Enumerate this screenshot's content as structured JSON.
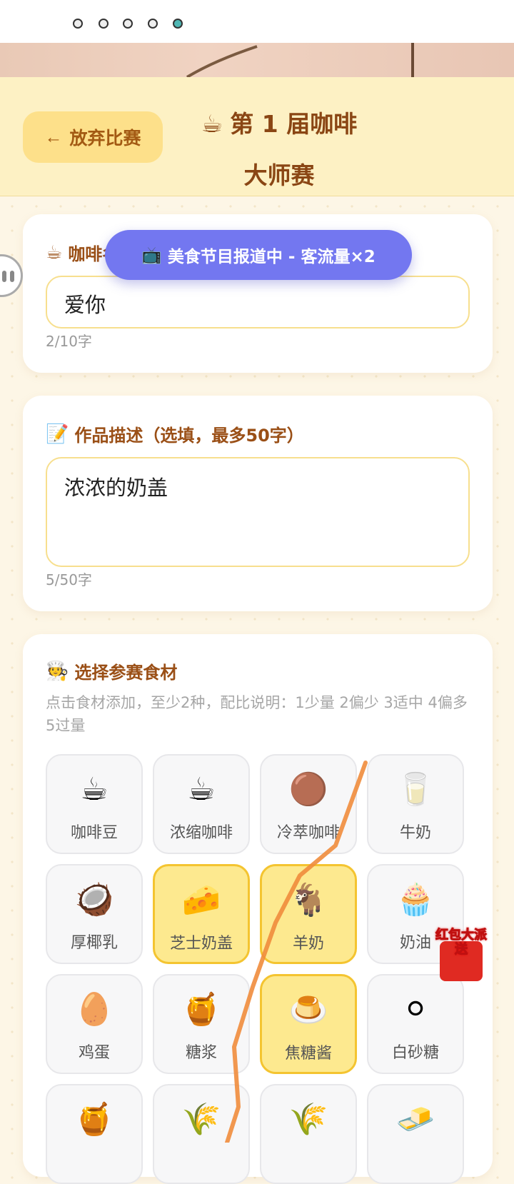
{
  "status_icons": [
    "notification-icon",
    "notification-icon",
    "notification-icon",
    "notification-icon",
    "notification-icon"
  ],
  "header": {
    "back_label": "放弃比赛",
    "title_emoji": "☕",
    "title_line1": "第 1 届咖啡",
    "title_line2": "大师赛"
  },
  "toast": {
    "icon": "📺",
    "text": "美食节目报道中 - 客流量×2"
  },
  "name_card": {
    "emoji": "☕",
    "label": "咖啡名称",
    "value": "爱你",
    "counter": "2/10字"
  },
  "desc_card": {
    "emoji": "📝",
    "label": "作品描述（选填，最多50字）",
    "value": "浓浓的奶盖",
    "counter": "5/50字"
  },
  "ingredient_card": {
    "emoji": "🧑‍🍳",
    "label": "选择参赛食材",
    "hint": "点击食材添加，至少2种，配比说明：1少量 2偏少 3适中 4偏多 5过量"
  },
  "ingredients": [
    {
      "icon": "☕",
      "label": "咖啡豆",
      "selected": false
    },
    {
      "icon": "☕",
      "label": "浓缩咖啡",
      "selected": false
    },
    {
      "icon": "🟤",
      "label": "冷萃咖啡",
      "selected": false
    },
    {
      "icon": "🥛",
      "label": "牛奶",
      "selected": false
    },
    {
      "icon": "🥥",
      "label": "厚椰乳",
      "selected": false
    },
    {
      "icon": "🧀",
      "label": "芝士奶盖",
      "selected": true
    },
    {
      "icon": "🐐",
      "label": "羊奶",
      "selected": true
    },
    {
      "icon": "🧁",
      "label": "奶油",
      "selected": false
    },
    {
      "icon": "🥚",
      "label": "鸡蛋",
      "selected": false
    },
    {
      "icon": "🍯",
      "label": "糖浆",
      "selected": false
    },
    {
      "icon": "🍮",
      "label": "焦糖酱",
      "selected": true
    },
    {
      "icon": "⚪",
      "label": "白砂糖",
      "selected": false
    },
    {
      "icon": "🍯",
      "label": "",
      "selected": false
    },
    {
      "icon": "🌾",
      "label": "",
      "selected": false
    },
    {
      "icon": "🌾",
      "label": "",
      "selected": false
    },
    {
      "icon": "🧈",
      "label": "",
      "selected": false
    }
  ],
  "red_packet": {
    "text": "红包大派送"
  },
  "colors": {
    "accent": "#9a4f16",
    "selected": "#fde98f",
    "toast": "#7377f0"
  }
}
